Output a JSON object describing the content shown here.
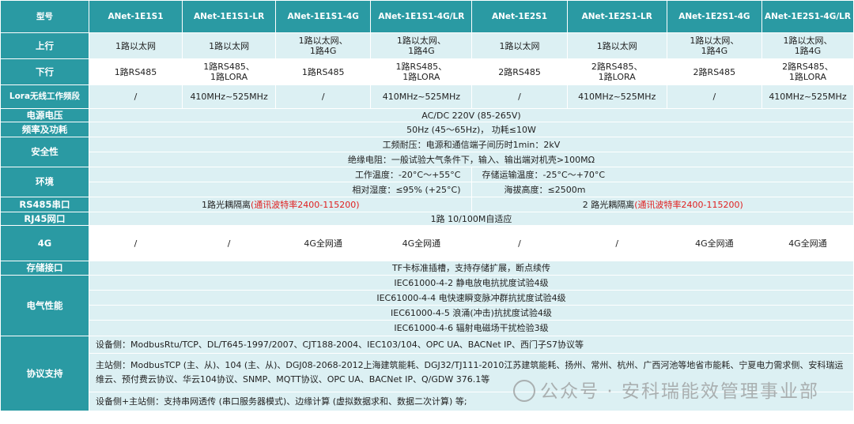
{
  "header": [
    "型号",
    "ANet-1E1S1",
    "ANet-1E1S1-LR",
    "ANet-1E1S1-4G",
    "ANet-1E1S1-4G/LR",
    "ANet-1E2S1",
    "ANet-1E2S1-LR",
    "ANet-1E2S1-4G",
    "ANet-1E2S1-4G/LR"
  ],
  "labels": {
    "uplink": "上行",
    "downlink": "下行",
    "lora": "Lora无线工作频段",
    "power": "电源电压",
    "freq": "频率及功耗",
    "safety": "安全性",
    "env": "环境",
    "rs485": "RS485串口",
    "rj45": "RJ45网口",
    "g4": "4G",
    "storage": "存储接口",
    "emc": "电气性能",
    "protocol": "协议支持"
  },
  "uplink": [
    "1路以太网",
    "1路以太网",
    "1路以太网、\n1路4G",
    "1路以太网、\n1路4G",
    "1路以太网",
    "1路以太网",
    "1路以太网、\n1路4G",
    "1路以太网、\n1路4G"
  ],
  "downlink": [
    "1路RS485",
    "1路RS485、\n1路LORA",
    "1路RS485",
    "1路RS485、\n1路LORA",
    "2路RS485",
    "2路RS485、\n1路LORA",
    "2路RS485",
    "2路RS485、\n1路LORA"
  ],
  "lora": [
    "/",
    "410MHz~525MHz",
    "/",
    "410MHz~525MHz",
    "/",
    "410MHz~525MHz",
    "/",
    "410MHz~525MHz"
  ],
  "power": "AC/DC 220V (85-265V)",
  "freq": "50Hz (45～65Hz)，   功耗≤10W",
  "safety1": "工频耐压：电源和通信端子间历时1min：2kV",
  "safety2": "绝缘电阻：一般试验大气条件下，输入、输出端对机壳>100MΩ",
  "env": {
    "temp_work": "工作温度：-20°C～+55°C",
    "temp_store": "存储运输温度：-25°C～+70°C",
    "humidity": "相对湿度：≤95% (+25°C)",
    "altitude": "海拔高度：≤2500m"
  },
  "rs485": {
    "a_text": "1路光耦隔离",
    "a_red": "(通讯波特率2400-115200)",
    "b_text": "2 路光耦隔离",
    "b_red": "(通讯波特率2400-115200)"
  },
  "rj45": "1路 10/100M自适应",
  "g4": [
    "/",
    "/",
    "4G全网通",
    "4G全网通",
    "/",
    "/",
    "4G全网通",
    "4G全网通"
  ],
  "storage": "TF卡标准插槽，支持存储扩展，断点续传",
  "emc": [
    "IEC61000-4-2 静电放电抗扰度试验4级",
    "IEC61000-4-4 电快速瞬变脉冲群抗扰度试验4级",
    "IEC61000-4-5 浪涌(冲击)抗扰度试验4级",
    "IEC61000-4-6 辐射电磁场干扰检验3级"
  ],
  "protocol": [
    "设备侧：ModbusRtu/TCP、DL/T645-1997/2007、CJT188-2004、IEC103/104、OPC UA、BACNet IP、西门子S7协议等",
    "主站侧：ModbusTCP (主、从)、104 (主、从)、DGJ08-2068-2012上海建筑能耗、DGJ32/TJ111-2010江苏建筑能耗、扬州、常州、杭州、广西河池等地省市能耗、宁夏电力需求侧、安科瑞运维云、预付费云协议、华云104协议、SNMP、MQTT协议、OPC UA、BACNet IP、Q/GDW 376.1等",
    "设备侧+主站侧：支持串网透传 (串口服务器模式)、边缘计算 (虚拟数据求和、数据二次计算) 等;"
  ],
  "watermark": "公众号 · 安科瑞能效管理事业部"
}
